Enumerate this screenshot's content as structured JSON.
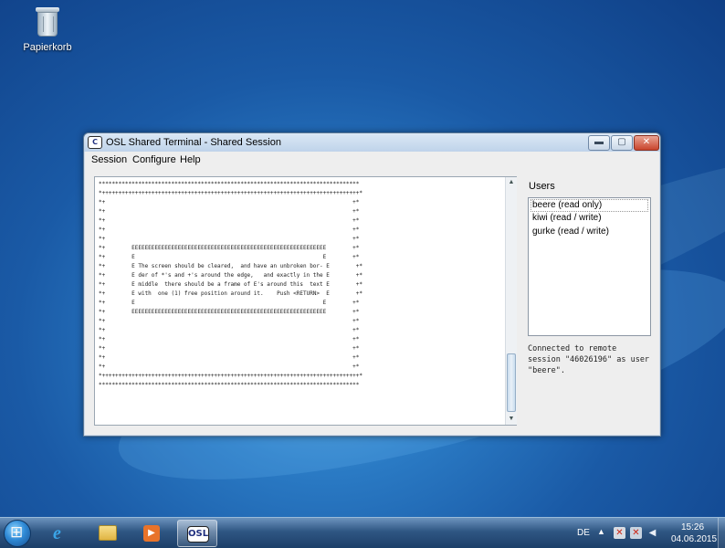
{
  "desktop": {
    "recycle_bin_label": "Papierkorb"
  },
  "window": {
    "title": "OSL Shared Terminal - Shared Session",
    "app_icon": "osl-logo-icon",
    "controls": {
      "minimize": "▬",
      "maximize": "▢",
      "close": "✕"
    }
  },
  "menu": {
    "items": [
      "Session",
      "Configure",
      "Help"
    ]
  },
  "terminal": {
    "lines": [
      "*******************************************************************************",
      "*++++++++++++++++++++++++++++++++++++++++++++++++++++++++++++++++++++++++++++++*",
      "*+                                                                           +*",
      "*+                                                                           +*",
      "*+                                                                           +*",
      "*+                                                                           +*",
      "*+                                                                           +*",
      "*+        EEEEEEEEEEEEEEEEEEEEEEEEEEEEEEEEEEEEEEEEEEEEEEEEEEEEEEEEEEE        +*",
      "*+        E                                                         E        +*",
      "*+        E The screen should be cleared,  and have an unbroken bor- E        +*",
      "*+        E der of *'s and +'s around the edge,   and exactly in the E        +*",
      "*+        E middle  there should be a frame of E's around this  text E        +*",
      "*+        E with  one (1) free position around it.    Push <RETURN>  E        +*",
      "*+        E                                                         E        +*",
      "*+        EEEEEEEEEEEEEEEEEEEEEEEEEEEEEEEEEEEEEEEEEEEEEEEEEEEEEEEEEEE        +*",
      "*+                                                                           +*",
      "*+                                                                           +*",
      "*+                                                                           +*",
      "*+                                                                           +*",
      "*+                                                                           +*",
      "*+                                                                           +*",
      "*++++++++++++++++++++++++++++++++++++++++++++++++++++++++++++++++++++++++++++++*",
      "*******************************************************************************"
    ],
    "scrollbar": {
      "up": "▲",
      "down": "▼",
      "position": 0.92
    }
  },
  "users": {
    "label": "Users",
    "items": [
      "beere (read only)",
      "kiwi (read / write)",
      "gurke (read / write)"
    ],
    "selected": "beere (read only)"
  },
  "status": {
    "text": "Connected to remote session \"46026196\" as user \"beere\"."
  },
  "taskbar": {
    "apps": [
      "internet-explorer-icon",
      "file-explorer-icon",
      "media-player-icon",
      "osl-terminal-icon"
    ],
    "active_app": "osl-terminal-icon",
    "osl_icon_text": "OSL",
    "language": "DE",
    "tray_arrow": "▲",
    "time": "15:26",
    "date": "04.06.2015"
  }
}
